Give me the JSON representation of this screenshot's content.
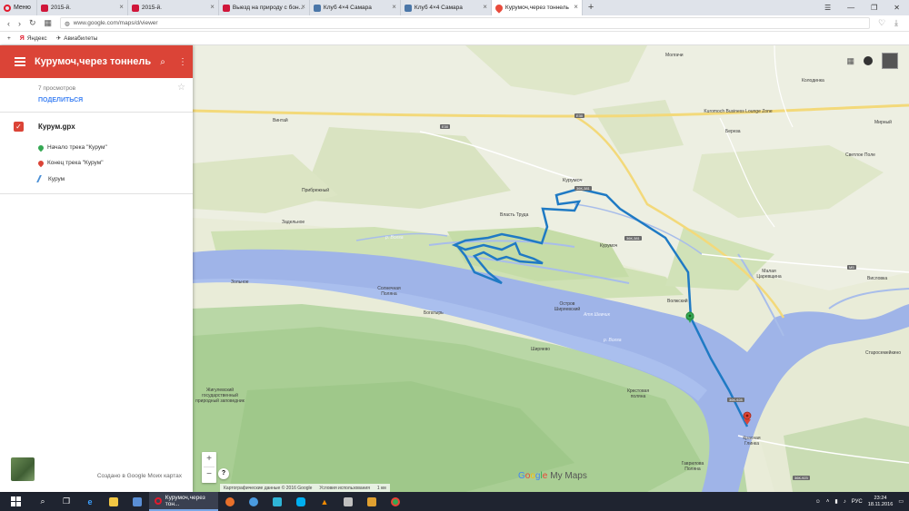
{
  "browser": {
    "menu_label": "Меню",
    "tabs": [
      {
        "title": "2015-й.",
        "favicon": "red-square-icon",
        "active": false
      },
      {
        "title": "2015-й.",
        "favicon": "red-square-icon",
        "active": false
      },
      {
        "title": "Выезд на природу с бон...",
        "favicon": "red-square-icon",
        "active": false
      },
      {
        "title": "Клуб 4×4 Самара",
        "favicon": "vk-icon",
        "active": false
      },
      {
        "title": "Клуб 4×4 Самара",
        "favicon": "vk-icon",
        "active": false
      },
      {
        "title": "Курумоч,через тоннель",
        "favicon": "map-pin-icon",
        "active": true
      }
    ],
    "url": "www.google.com/maps/d/viewer",
    "bookmarks": [
      {
        "label": "Яндекс"
      },
      {
        "label": "Авиабилеты"
      }
    ]
  },
  "panel": {
    "title": "Курумоч,через тоннель",
    "views": "7 просмотров",
    "share": "ПОДЕЛИТЬСЯ",
    "layer": {
      "name": "Курум.gpx",
      "checked": true,
      "features": [
        {
          "label": "Начало трека \"Курум\"",
          "icon": "green-pin-icon",
          "color": "#34a853"
        },
        {
          "label": "Конец трека \"Курум\"",
          "icon": "red-pin-icon",
          "color": "#db4437"
        },
        {
          "label": "Курум",
          "icon": "line-icon",
          "color": "#4a8fd6"
        }
      ]
    },
    "created": "Создано в Google Моих картах"
  },
  "map": {
    "places": [
      "Винтай",
      "Молгачи",
      "Колодинка",
      "Kuromoch Business Lounge Zone",
      "Березa",
      "Мирный",
      "Светлое Поле",
      "Курумоч",
      "Прибрежный",
      "Власть Труда",
      "Задельное",
      "Курумоч",
      "Малая Царевщина",
      "Висловка",
      "Зольное",
      "Солнечная Поляна",
      "Богатырь",
      "Остров Ширяевский",
      "Ширяево",
      "Волжский",
      "Жигулевский государственный природный заповедник",
      "Крестовая поляна",
      "Старосемейкино",
      "Красная Глинка",
      "Гаврилова Поляна"
    ],
    "roads": [
      "Е30",
      "Е30",
      "36К-381",
      "36К-381",
      "М5",
      "36К-928",
      "36К-923"
    ],
    "water_labels": [
      "р. Волга",
      "р. Волга",
      "Атя Шевчик"
    ],
    "logo_text": "My Maps",
    "attribution": "Картографические данные © 2016 Google",
    "terms": "Условия использования",
    "scale": "1 км",
    "zoom_in": "+",
    "zoom_out": "−",
    "help": "?",
    "route_color": "#1f7ac4"
  },
  "taskbar": {
    "active_app": "Курумоч,через тон...",
    "lang": "РУС",
    "time": "23:24",
    "date": "18.11.2016"
  }
}
